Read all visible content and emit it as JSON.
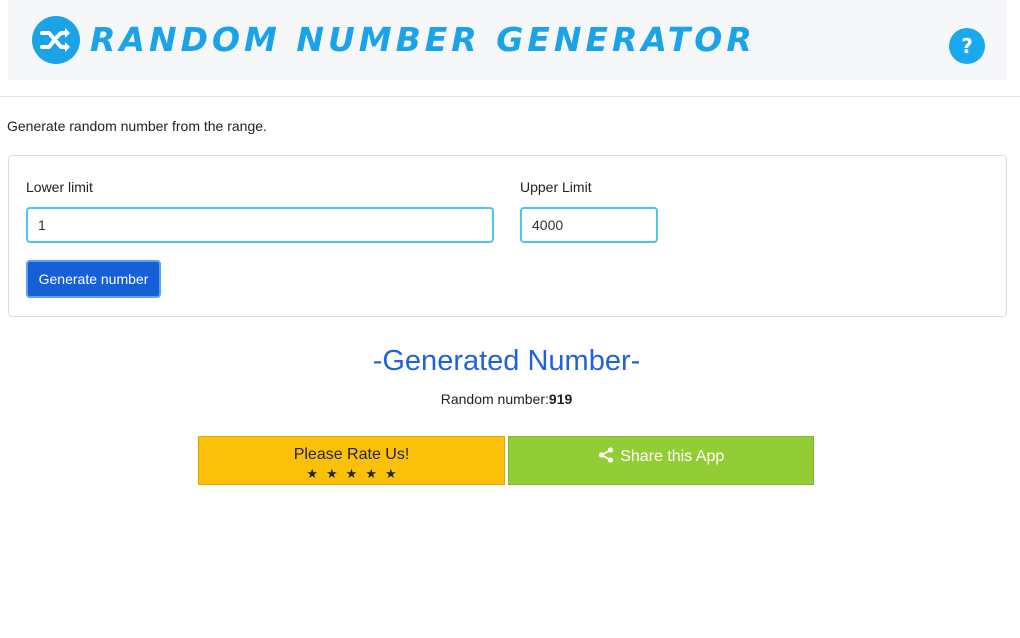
{
  "header": {
    "title": "RANDOM NUMBER GENERATOR",
    "logo_icon": "shuffle-icon",
    "help_label": "?",
    "accent_color": "#1aa3e8"
  },
  "intro_text": "Generate random number from the range.",
  "form": {
    "lower_label": "Lower limit",
    "lower_value": "1",
    "upper_label": "Upper Limit",
    "upper_value": "4000",
    "generate_label": "Generate number"
  },
  "result": {
    "heading": "-Generated Number-",
    "label": "Random number:",
    "value": "919"
  },
  "actions": {
    "rate_label": "Please Rate Us!",
    "rate_stars": "★★★★★",
    "share_label": "Share this App",
    "share_icon": "share-icon"
  }
}
